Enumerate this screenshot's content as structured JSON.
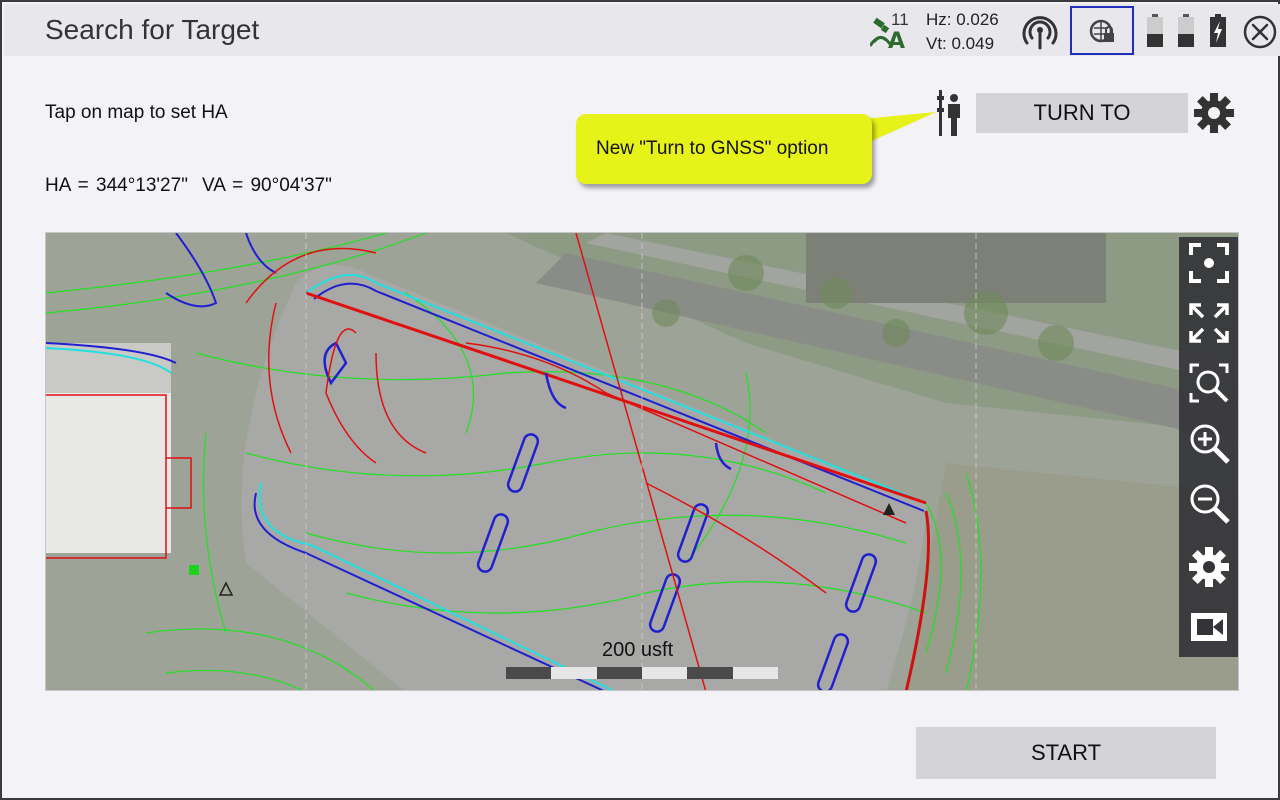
{
  "header": {
    "title": "Search for Target",
    "satellite_count": "11",
    "hz": "Hz: 0.026",
    "vt": "Vt: 0.049"
  },
  "main": {
    "instruction": "Tap on map to set HA",
    "ha": "HA = 344°13'27\"",
    "va": "VA = 90°04'37\"",
    "turn_to_label": "TURN TO",
    "callout_text": "New \"Turn to GNSS\" option",
    "start_label": "START"
  },
  "map": {
    "scale_label": "200 usft",
    "toolbar_icons": [
      "focus-icon",
      "zoom-extents-icon",
      "zoom-window-icon",
      "zoom-in-icon",
      "zoom-out-icon",
      "map-settings-icon",
      "video-icon"
    ]
  },
  "colors": {
    "callout": "#e6f218",
    "header_bg": "#e8e8ec",
    "button_bg": "#d4d4d8",
    "gnss_border": "#1f2fb8",
    "toolbar_bg": "#343438"
  }
}
